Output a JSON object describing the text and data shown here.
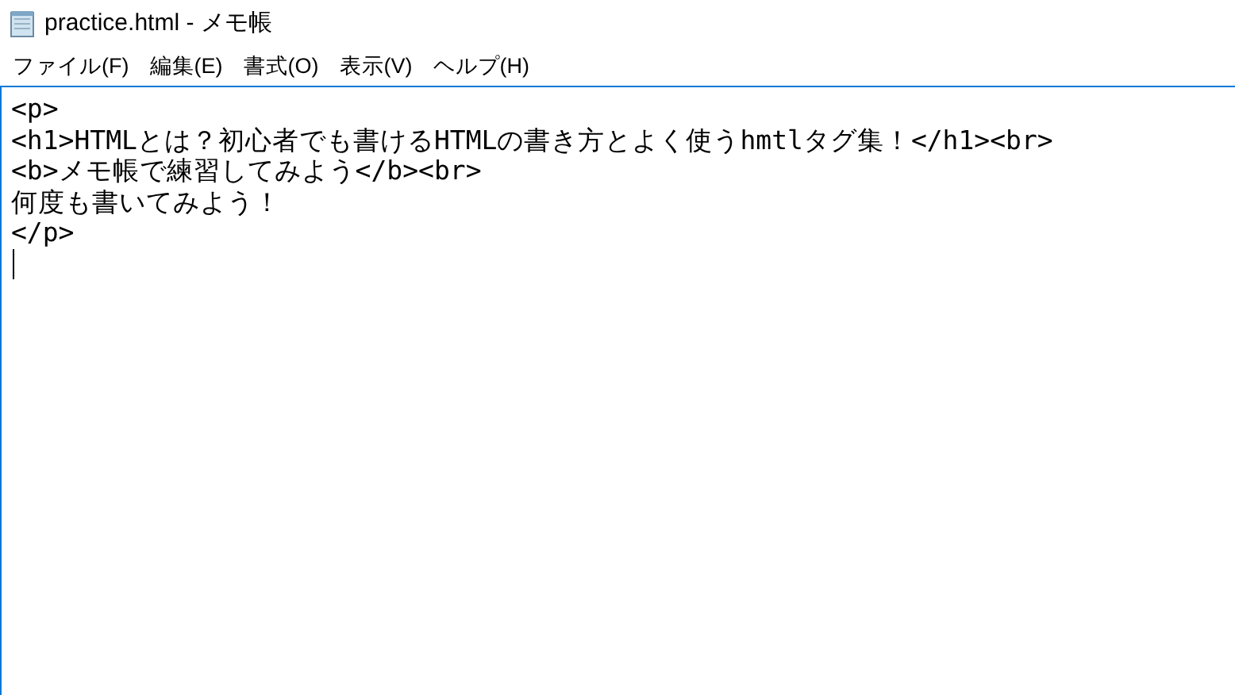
{
  "window": {
    "title": "practice.html - メモ帳"
  },
  "menu": [
    {
      "label": "ファイル(F)"
    },
    {
      "label": "編集(E)"
    },
    {
      "label": "書式(O)"
    },
    {
      "label": "表示(V)"
    },
    {
      "label": "ヘルプ(H)"
    }
  ],
  "editor": {
    "lines": [
      "<p>",
      "<h1>HTMLとは？初心者でも書けるHTMLの書き方とよく使うhmtlタグ集！</h1><br>",
      "<b>メモ帳で練習してみよう</b><br>",
      "何度も書いてみよう！",
      "</p>"
    ]
  }
}
